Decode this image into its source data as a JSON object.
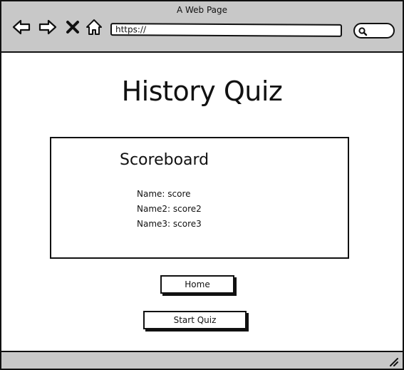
{
  "browser": {
    "window_title": "A Web Page",
    "url": "https://",
    "icons": {
      "back": "back-arrow-icon",
      "forward": "forward-arrow-icon",
      "close": "close-icon",
      "home": "home-icon",
      "search": "search-icon",
      "resize": "resize-grip-icon"
    }
  },
  "page": {
    "title": "History Quiz"
  },
  "scoreboard": {
    "title": "Scoreboard",
    "entries": [
      "Name: score",
      "Name2: score2",
      "Name3: score3"
    ]
  },
  "actions": {
    "home_label": "Home",
    "start_label": "Start Quiz"
  },
  "colors": {
    "chrome": "#c8c8c8",
    "ink": "#111111",
    "background": "#ffffff"
  }
}
